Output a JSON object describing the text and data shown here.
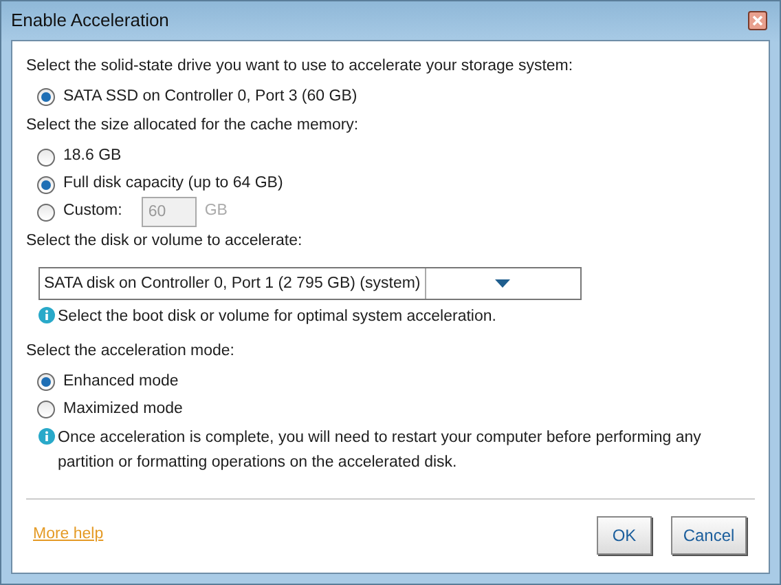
{
  "window": {
    "title": "Enable Acceleration"
  },
  "sections": [
    {
      "kind": "radios",
      "label": "Select the solid-state drive you want to use to accelerate your storage system:",
      "options": [
        {
          "label": "SATA SSD on Controller 0, Port 3 (60 GB)",
          "selected": true
        }
      ]
    },
    {
      "kind": "radios",
      "label": "Select the size allocated for the cache memory:",
      "options": [
        {
          "label": "18.6 GB",
          "selected": false
        },
        {
          "label": "Full disk capacity (up to 64 GB)",
          "selected": true
        },
        {
          "label": "Custom:",
          "selected": false,
          "field": {
            "value": "60",
            "unit": "GB",
            "disabled": true
          }
        }
      ]
    },
    {
      "kind": "dropdown",
      "label": "Select the disk or volume to accelerate:",
      "value": "SATA disk on Controller 0, Port 1 (2 795 GB) (system)",
      "info": "Select the boot disk or volume for optimal system acceleration."
    },
    {
      "kind": "radios",
      "label": "Select the acceleration mode:",
      "options": [
        {
          "label": "Enhanced mode",
          "selected": true
        },
        {
          "label": "Maximized mode",
          "selected": false
        }
      ],
      "info": "Once acceleration is complete, you will need to restart your computer before performing any partition or formatting operations on the accelerated disk."
    }
  ],
  "footer": {
    "link": "More help",
    "buttons": [
      "OK",
      "Cancel"
    ]
  }
}
